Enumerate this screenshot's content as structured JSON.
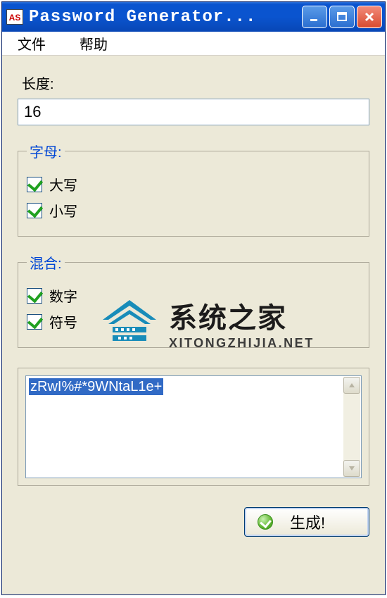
{
  "window": {
    "title": "Password Generator...",
    "icon_text": "AS"
  },
  "menu": {
    "file": "文件",
    "help": "帮助"
  },
  "length": {
    "label": "长度:",
    "value": "16"
  },
  "group_letters": {
    "legend": "字母:",
    "uppercase": {
      "label": "大写",
      "checked": true
    },
    "lowercase": {
      "label": "小写",
      "checked": true
    }
  },
  "group_mix": {
    "legend": "混合:",
    "digits": {
      "label": "数字",
      "checked": true
    },
    "symbols": {
      "label": "符号",
      "checked": true
    }
  },
  "output": {
    "value": "zRwI%#*9WNtaL1e+"
  },
  "generate": {
    "label": "生成!"
  },
  "watermark": {
    "cn": "系统之家",
    "en": "XITONGZHIJIA.NET"
  }
}
